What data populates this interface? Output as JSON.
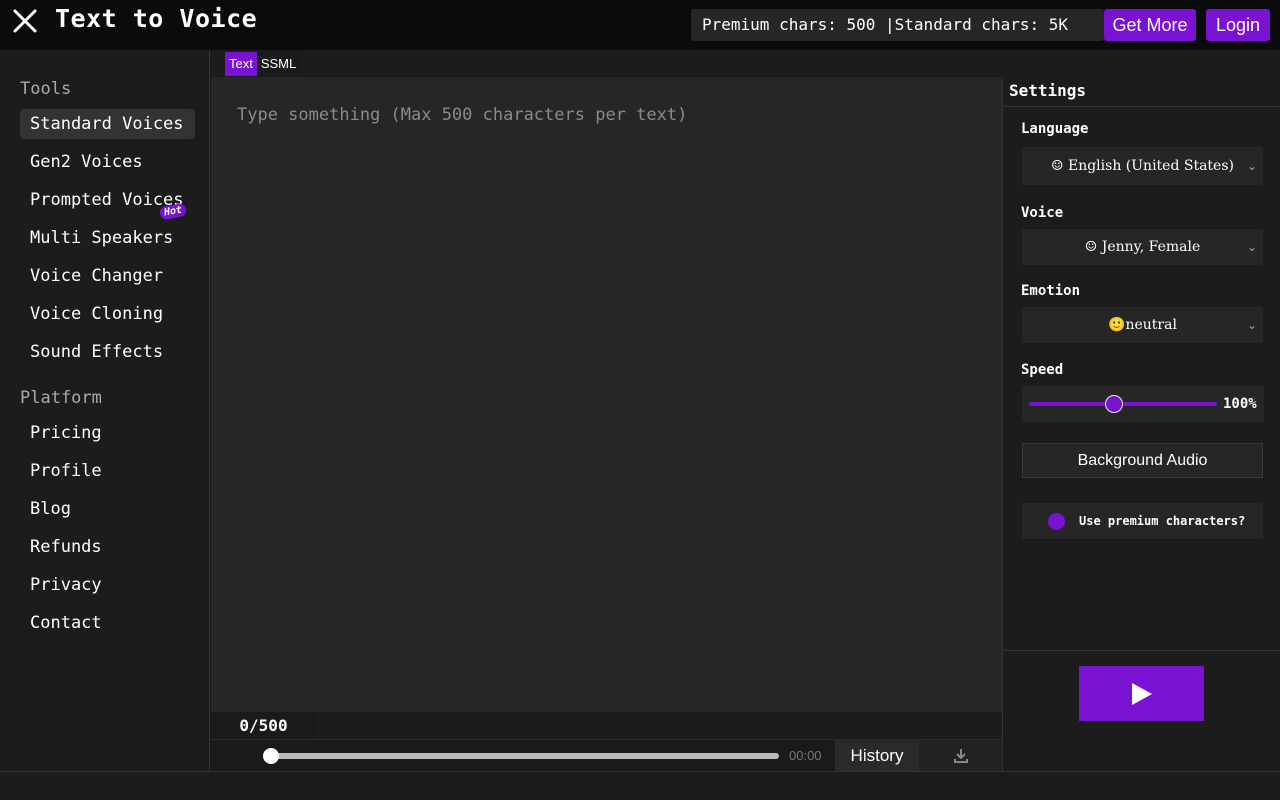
{
  "header": {
    "title": "Text to Voice",
    "chars_info": "Premium chars: 500 |Standard chars: 5K",
    "get_more": "Get More",
    "login": "Login"
  },
  "sidebar": {
    "tools_title": "Tools",
    "tools": [
      {
        "label": "Standard Voices",
        "active": true
      },
      {
        "label": "Gen2 Voices"
      },
      {
        "label": "Prompted Voices",
        "badge": "Hot"
      },
      {
        "label": "Multi Speakers"
      },
      {
        "label": "Voice Changer"
      },
      {
        "label": "Voice Cloning"
      },
      {
        "label": "Sound Effects"
      }
    ],
    "platform_title": "Platform",
    "platform": [
      {
        "label": "Pricing"
      },
      {
        "label": "Profile"
      },
      {
        "label": "Blog"
      },
      {
        "label": "Refunds"
      },
      {
        "label": "Privacy"
      },
      {
        "label": "Contact"
      }
    ]
  },
  "editor": {
    "tabs": [
      {
        "label": "Text",
        "active": true
      },
      {
        "label": "SSML",
        "active": false
      }
    ],
    "placeholder": "Type something (Max 500 characters per text)",
    "counter": "0/500",
    "time": "00:00",
    "history": "History",
    "playback_progress": 0
  },
  "settings": {
    "title": "Settings",
    "language_label": "Language",
    "language_value": "☺ English (United States)",
    "voice_label": "Voice",
    "voice_value": "☺ Jenny, Female",
    "emotion_label": "Emotion",
    "emotion_value": "🙂neutral",
    "speed_label": "Speed",
    "speed_value": "100%",
    "speed_fraction": 0.45,
    "background_audio": "Background Audio",
    "premium_label": "Use premium characters?"
  },
  "colors": {
    "accent": "#7a12d4",
    "background": "#1c1c1c",
    "header_bg": "#0b0b0b",
    "editor_bg": "#262626"
  },
  "icons": {
    "close": "close-icon",
    "play": "play-icon",
    "download": "download-icon",
    "chevron": "chevron-down-icon"
  }
}
